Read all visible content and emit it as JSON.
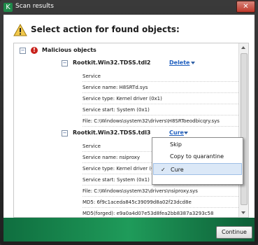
{
  "window": {
    "title": "Scan results",
    "close_glyph": "✕"
  },
  "heading": "Select action for found objects:",
  "group": {
    "label": "Malicious objects",
    "error_glyph": "!"
  },
  "threats": [
    {
      "name": "Rootkit.Win32.TDSS.tdl2",
      "action": "Delete",
      "details": [
        "Service",
        "Service name: H8SRTd.sys",
        "Service type: Kernel driver (0x1)",
        "Service start: System (0x1)",
        "File: C:\\Windows\\system32\\drivers\\H8SRToeodbicqry.sys"
      ]
    },
    {
      "name": "Rootkit.Win32.TDSS.tdl3",
      "action": "Cure",
      "details": [
        "Service",
        "Service name: nsiproxy",
        "Service type: Kernel driver (0x",
        "Service start: System (0x1)",
        "File: C:\\Windows\\system32\\drivers\\nsiproxy.sys",
        "MD5: 6f9c1aceda845c39099d8a02f23dcd8e",
        "MD5(forged): e9a0a4d07e53d8fea2bb8387a3293c58"
      ]
    }
  ],
  "dropdown": {
    "options": [
      "Skip",
      "Copy to quarantine",
      "Cure"
    ],
    "selected": "Cure",
    "check_glyph": "✓"
  },
  "expander_glyph": "−",
  "continue_label": "Continue",
  "colors": {
    "brand_green": "#1f9b5a",
    "link_blue": "#1f5fbf",
    "error_red": "#c8211b"
  }
}
